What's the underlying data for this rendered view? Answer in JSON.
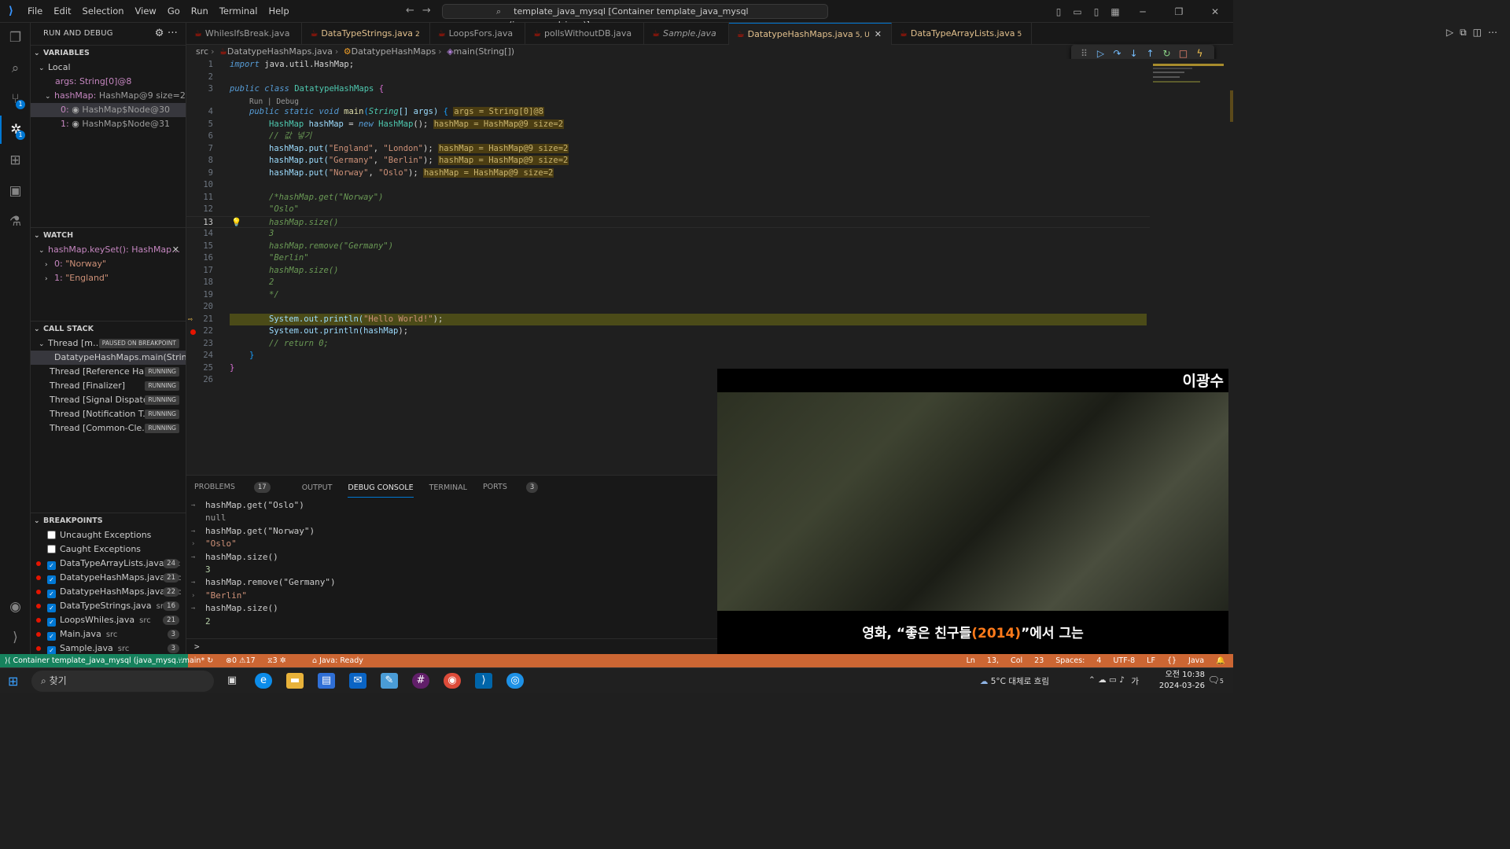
{
  "titlebar": {
    "menu": [
      "File",
      "Edit",
      "Selection",
      "View",
      "Go",
      "Run",
      "Terminal",
      "Help"
    ],
    "search": "template_java_mysql [Container template_java_mysql (java_mysql_java)]"
  },
  "activity": {
    "scm_badge": "1",
    "debug_badge": "1"
  },
  "sidebar": {
    "title": "RUN AND DEBUG",
    "variables": {
      "header": "VARIABLES",
      "local": "Local",
      "args": "args: String[0]@8",
      "hashmap_name": "hashMap:",
      "hashmap_val": "HashMap@9 size=2",
      "node0": "0: ",
      "node0_val": "HashMap$Node@30",
      "node1": "1: ",
      "node1_val": "HashMap$Node@31"
    },
    "watch": {
      "header": "WATCH",
      "expr": "hashMap.keySet(): HashMap…",
      "i0": "0: ",
      "i0v": "\"Norway\"",
      "i1": "1: ",
      "i1v": "\"England\""
    },
    "callstack": {
      "header": "CALL STACK",
      "main_thread": "Thread [m…",
      "paused": "PAUSED ON BREAKPOINT",
      "frame": "DatatypeHashMaps.main(String[",
      "threads": [
        {
          "name": "Thread [Reference Ha...",
          "state": "RUNNING"
        },
        {
          "name": "Thread [Finalizer]",
          "state": "RUNNING"
        },
        {
          "name": "Thread [Signal Dispatc...",
          "state": "RUNNING"
        },
        {
          "name": "Thread [Notification T...",
          "state": "RUNNING"
        },
        {
          "name": "Thread [Common-Cle...",
          "state": "RUNNING"
        }
      ]
    },
    "breakpoints": {
      "header": "BREAKPOINTS",
      "uncaught": "Uncaught Exceptions",
      "caught": "Caught Exceptions",
      "items": [
        {
          "file": "DataTypeArrayLists.java",
          "src": "src",
          "line": "24"
        },
        {
          "file": "DatatypeHashMaps.java",
          "src": "src",
          "line": "21"
        },
        {
          "file": "DatatypeHashMaps.java",
          "src": "src",
          "line": "22"
        },
        {
          "file": "DataTypeStrings.java",
          "src": "src",
          "line": "16"
        },
        {
          "file": "LoopsWhiles.java",
          "src": "src",
          "line": "21"
        },
        {
          "file": "Main.java",
          "src": "src",
          "line": "3"
        },
        {
          "file": "Sample.java",
          "src": "src",
          "line": "3"
        }
      ]
    }
  },
  "tabs": [
    {
      "label": "WhilesIfsBreak.java",
      "count": ""
    },
    {
      "label": "DataTypeStrings.java",
      "count": "2"
    },
    {
      "label": "LoopsFors.java",
      "count": ""
    },
    {
      "label": "pollsWithoutDB.java",
      "count": ""
    },
    {
      "label": "Sample.java",
      "count": ""
    },
    {
      "label": "DatatypeHashMaps.java",
      "count": "5, U"
    },
    {
      "label": "DataTypeArrayLists.java",
      "count": "5"
    }
  ],
  "breadcrumb": {
    "a": "src",
    "b": "DatatypeHashMaps.java",
    "c": "DatatypeHashMaps",
    "d": "main(String[])"
  },
  "code": {
    "lens": "Run | Debug",
    "l1_import": "import",
    "l1_rest": " java.util.HashMap;",
    "l3_public": "public",
    "l3_class": "class",
    "l3_name": "DatatypeHashMaps",
    "l3_brace": "{",
    "l4_public": "public",
    "l4_static": "static",
    "l4_void": "void",
    "l4_main": "main",
    "l4_string": "String",
    "l4_rest": "[] args)",
    "l4_brace": "{",
    "l4_inl": "args = String[0]@8",
    "l5_type": "HashMap",
    "l5_var": "hashMap",
    "l5_eq": "=",
    "l5_new": "new",
    "l5_ctor": "HashMap",
    "l5_end": "();",
    "l5_inl": "hashMap = HashMap@9 size=2",
    "l6": "// 값 넣기",
    "l7_a": "hashMap.put(",
    "l7_s1": "\"England\"",
    "l7_c": ", ",
    "l7_s2": "\"London\"",
    "l7_e": ");",
    "l7_inl": "hashMap = HashMap@9 size=2",
    "l8_a": "hashMap.put(",
    "l8_s1": "\"Germany\"",
    "l8_c": ", ",
    "l8_s2": "\"Berlin\"",
    "l8_e": ");",
    "l8_inl": "hashMap = HashMap@9 size=2",
    "l9_a": "hashMap.put(",
    "l9_s1": "\"Norway\"",
    "l9_c": ", ",
    "l9_s2": "\"Oslo\"",
    "l9_e": ");",
    "l9_inl": "hashMap = HashMap@9 size=2",
    "l11": "/*hashMap.get(\"Norway\")",
    "l12": "\"Oslo\"",
    "l13": "hashMap.size()",
    "l14": "3",
    "l15": "hashMap.remove(\"Germany\")",
    "l16": "\"Berlin\"",
    "l17": "hashMap.size()",
    "l18": "2",
    "l19": "*/",
    "l21_a": "System.out.println(",
    "l21_s": "\"Hello World!\"",
    "l21_e": ");",
    "l22_a": "System.out.println(",
    "l22_v": "hashMap",
    "l22_e": ");",
    "l23": "// return 0;",
    "l24": "}",
    "l25": "}"
  },
  "panel": {
    "tabs": {
      "problems": "PROBLEMS",
      "problems_count": "17",
      "output": "OUTPUT",
      "debug": "DEBUG CONSOLE",
      "terminal": "TERMINAL",
      "ports": "PORTS",
      "ports_count": "3"
    },
    "lines": [
      {
        "kind": "in",
        "text": "hashMap.get(\"Oslo\")"
      },
      {
        "kind": "nul",
        "text": "null"
      },
      {
        "kind": "in",
        "text": "hashMap.get(\"Norway\")"
      },
      {
        "kind": "str",
        "text": "\"Oslo\""
      },
      {
        "kind": "in",
        "text": "hashMap.size()"
      },
      {
        "kind": "res",
        "text": "3"
      },
      {
        "kind": "in",
        "text": "hashMap.remove(\"Germany\")"
      },
      {
        "kind": "str",
        "text": "\"Berlin\""
      },
      {
        "kind": "in",
        "text": "hashMap.size()"
      },
      {
        "kind": "res",
        "text": "2"
      }
    ],
    "prompt": ">"
  },
  "video": {
    "name": "이광수",
    "cap_a": "영화, “좋은 친구들",
    "cap_year": "(2014)",
    "cap_b": "”에서 그는"
  },
  "status": {
    "remote": "Container template_java_mysql (java_mysq...",
    "branch": "main*",
    "errors": "0",
    "warnings": "17",
    "ports": "3",
    "java": "Java: Ready",
    "right": "Ln 13, Col 23   Spaces: 4   UTF-8   LF   {} Java"
  },
  "taskbar": {
    "search": "찾기",
    "weather": "5°C  대체로 흐림",
    "time": "오전 10:38",
    "date": "2024-03-26",
    "ime": "가",
    "notif": "5"
  }
}
